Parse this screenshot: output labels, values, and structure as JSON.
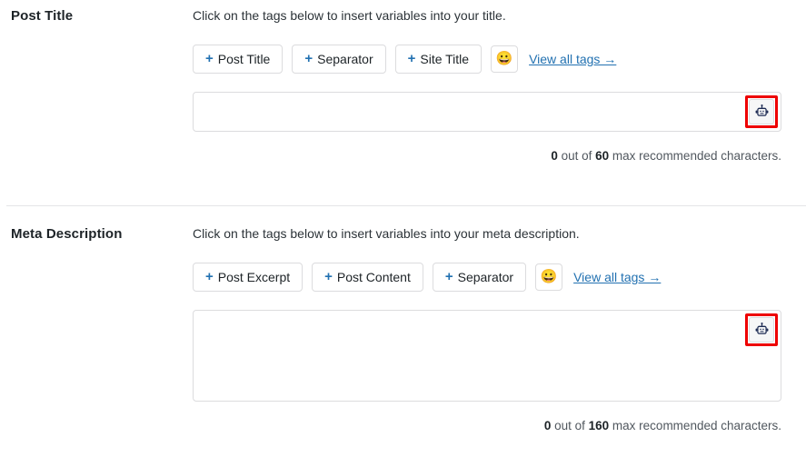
{
  "sections": [
    {
      "id": "post-title",
      "title": "Post Title",
      "instruction": "Click on the tags below to insert variables into your title.",
      "tags": [
        {
          "plus": "+",
          "label": "Post Title"
        },
        {
          "plus": "+",
          "label": "Separator"
        },
        {
          "plus": "+",
          "label": "Site Title"
        }
      ],
      "emoji_button": {
        "icon": "smiley-face-icon",
        "glyph": "😀"
      },
      "view_all_link": "View all tags →",
      "field": {
        "type": "input",
        "value": "",
        "placeholder": ""
      },
      "ai_button": {
        "icon": "robot-icon",
        "highlighted": true
      },
      "counter": {
        "count": "0",
        "middle": " out of ",
        "max": "60",
        "suffix": " max recommended characters."
      }
    },
    {
      "id": "meta-description",
      "title": "Meta Description",
      "instruction": "Click on the tags below to insert variables into your meta description.",
      "tags": [
        {
          "plus": "+",
          "label": "Post Excerpt"
        },
        {
          "plus": "+",
          "label": "Post Content"
        },
        {
          "plus": "+",
          "label": "Separator"
        }
      ],
      "emoji_button": {
        "icon": "smiley-face-icon",
        "glyph": "😀"
      },
      "view_all_link": "View all tags →",
      "field": {
        "type": "textarea",
        "value": "",
        "placeholder": ""
      },
      "ai_button": {
        "icon": "robot-icon",
        "highlighted": true
      },
      "counter": {
        "count": "0",
        "middle": " out of ",
        "max": "160",
        "suffix": " max recommended characters."
      }
    }
  ],
  "colors": {
    "accent_link": "#2271b1",
    "highlight_border": "#ee0000",
    "border": "#dcdcde",
    "text": "#1d2327",
    "muted_text": "#50575e"
  }
}
